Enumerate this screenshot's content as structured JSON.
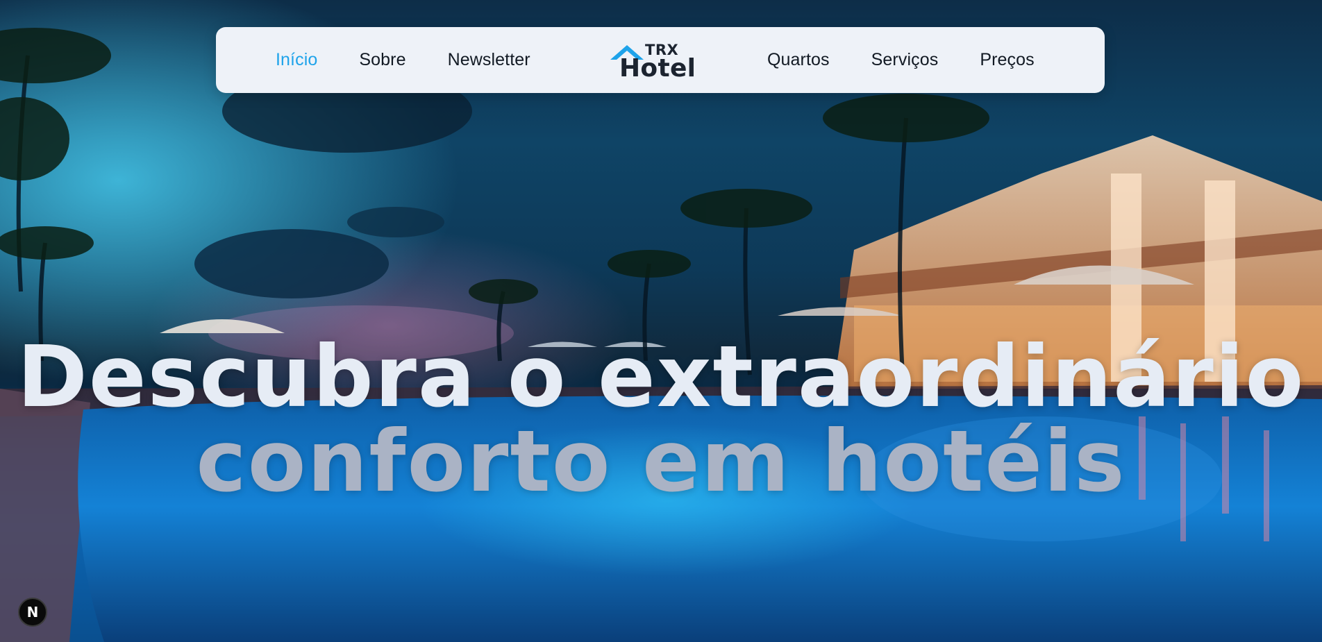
{
  "nav": {
    "left": [
      {
        "label": "Início",
        "active": true
      },
      {
        "label": "Sobre",
        "active": false
      },
      {
        "label": "Newsletter",
        "active": false
      }
    ],
    "right": [
      {
        "label": "Quartos",
        "active": false
      },
      {
        "label": "Serviços",
        "active": false
      },
      {
        "label": "Preços",
        "active": false
      }
    ]
  },
  "logo": {
    "top_text": "TRX",
    "main_text": "Hotel",
    "icon": "house-roof-icon"
  },
  "hero": {
    "line1": "Descubra o extraordinário",
    "line2": "conforto em hotéis",
    "background": "hotel-pool-night-photo"
  },
  "dev_badge": {
    "label": "N",
    "icon": "nextjs-icon"
  },
  "colors": {
    "active_link": "#1ea3ea",
    "nav_text": "#121a24",
    "navbar_bg": "#eef2f8",
    "headline_light": "#e6ecf5",
    "headline_muted": "#aab3c5"
  }
}
